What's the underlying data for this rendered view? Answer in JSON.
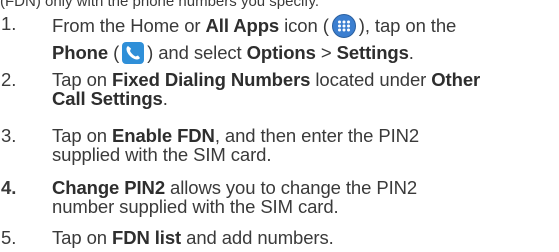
{
  "top_fragment": "(FDN) only with the phone numbers you specify.",
  "icons": {
    "apps": "all-apps-icon",
    "phone": "phone-icon",
    "apps_color": "#3c7fd0",
    "phone_color": "#2f8fd8"
  },
  "steps": [
    {
      "num": "1.",
      "t1": "From the Home or ",
      "b1": "All Apps",
      "t2": " icon (",
      "t3": "), tap on the",
      "b2": "Phone",
      "t4": " (",
      "t5": ") and select ",
      "b3": "Options",
      "t6": " > ",
      "b4": "Settings",
      "t7": "."
    },
    {
      "num": "2.",
      "t1": "Tap on ",
      "b1": "Fixed Dialing Numbers",
      "t2": " located under ",
      "b2": "Other",
      "b3": "Call Settings",
      "t3": "."
    },
    {
      "num": "3.",
      "t1": "Tap on ",
      "b1": "Enable FDN",
      "t2": ", and then enter the PIN2",
      "t3": "supplied with the SIM card."
    },
    {
      "num": "4.",
      "b1": "Change PIN2",
      "t1": " allows you to change the PIN2",
      "t2": "number supplied with the SIM card."
    },
    {
      "num": "5.",
      "t1": "Tap on ",
      "b1": "FDN list",
      "t2": " and add numbers."
    }
  ]
}
